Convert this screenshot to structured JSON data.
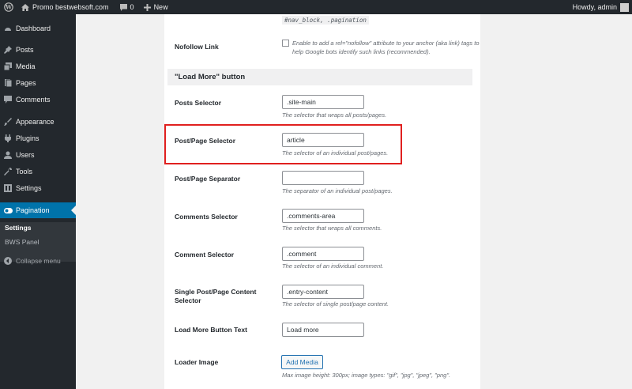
{
  "adminbar": {
    "site_name": "Promo bestwebsoft.com",
    "comments_count": "0",
    "new_label": "New",
    "howdy": "Howdy, admin"
  },
  "sidebar": {
    "items": [
      {
        "label": "Dashboard",
        "icon": "dashboard-icon"
      },
      {
        "label": "Posts",
        "icon": "pin-icon"
      },
      {
        "label": "Media",
        "icon": "media-icon"
      },
      {
        "label": "Pages",
        "icon": "page-icon"
      },
      {
        "label": "Comments",
        "icon": "comment-icon"
      },
      {
        "label": "Appearance",
        "icon": "brush-icon"
      },
      {
        "label": "Plugins",
        "icon": "plugin-icon"
      },
      {
        "label": "Users",
        "icon": "user-icon"
      },
      {
        "label": "Tools",
        "icon": "wrench-icon"
      },
      {
        "label": "Settings",
        "icon": "settings-icon"
      },
      {
        "label": "Pagination",
        "icon": "toggle-icon"
      }
    ],
    "submenu": [
      "Settings",
      "BWS Panel"
    ],
    "collapse_label": "Collapse menu"
  },
  "content": {
    "pagination_code": "#nav_block, .pagination",
    "nofollow": {
      "label": "Nofollow Link",
      "text": "Enable to add a rel=\"nofollow\" attribute to your anchor (aka link) tags to help Google bots identify such links (recommended)."
    },
    "section_title": "\"Load More\" button",
    "fields": [
      {
        "label": "Posts Selector",
        "value": ".site-main",
        "desc": "The selector that wraps all posts/pages."
      },
      {
        "label": "Post/Page Selector",
        "value": "article",
        "desc": "The selector of an individual post/pages."
      },
      {
        "label": "Post/Page Separator",
        "value": "",
        "desc": "The separator of an individual post/pages."
      },
      {
        "label": "Comments Selector",
        "value": ".comments-area",
        "desc": "The selector that wraps all comments."
      },
      {
        "label": "Comment Selector",
        "value": ".comment",
        "desc": "The selector of an individual comment."
      },
      {
        "label": "Single Post/Page Content Selector",
        "value": ".entry-content",
        "desc": "The selector of single post/page content."
      },
      {
        "label": "Load More Button Text",
        "value": "Load more",
        "desc": ""
      }
    ],
    "loader": {
      "label": "Loader Image",
      "button": "Add Media",
      "desc": "Max image height: 300px; image types: \"gif\", \"jpg\", \"jpeg\", \"png\"."
    }
  },
  "colors": {
    "adminbar_bg": "#23282d",
    "sidebar_active": "#0073aa",
    "highlight": "#e0201f"
  }
}
